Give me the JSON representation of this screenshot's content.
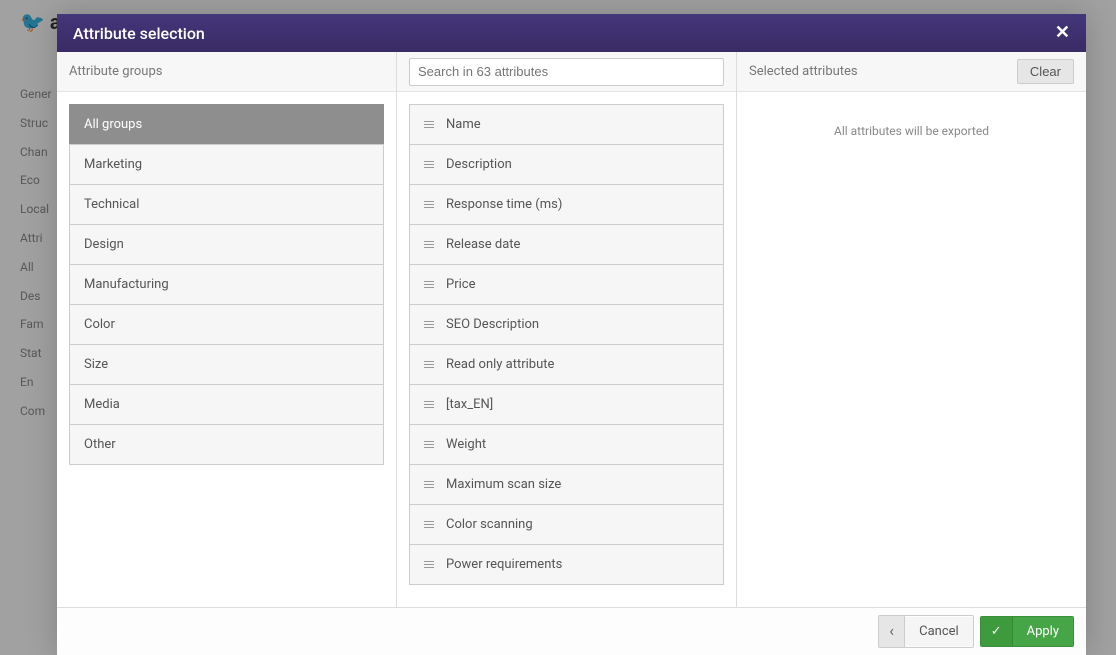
{
  "modal": {
    "title": "Attribute selection"
  },
  "columns": {
    "groups_header": "Attribute groups",
    "search_placeholder": "Search in 63 attributes",
    "selected_header": "Selected attributes",
    "clear_label": "Clear",
    "empty_message": "All attributes will be exported"
  },
  "groups": [
    {
      "label": "All groups",
      "active": true
    },
    {
      "label": "Marketing",
      "active": false
    },
    {
      "label": "Technical",
      "active": false
    },
    {
      "label": "Design",
      "active": false
    },
    {
      "label": "Manufacturing",
      "active": false
    },
    {
      "label": "Color",
      "active": false
    },
    {
      "label": "Size",
      "active": false
    },
    {
      "label": "Media",
      "active": false
    },
    {
      "label": "Other",
      "active": false
    }
  ],
  "attributes": [
    {
      "label": "Name"
    },
    {
      "label": "Description"
    },
    {
      "label": "Response time (ms)"
    },
    {
      "label": "Release date"
    },
    {
      "label": "Price"
    },
    {
      "label": "SEO Description"
    },
    {
      "label": "Read only attribute"
    },
    {
      "label": "[tax_EN]"
    },
    {
      "label": "Weight"
    },
    {
      "label": "Maximum scan size"
    },
    {
      "label": "Color scanning"
    },
    {
      "label": "Power requirements"
    }
  ],
  "footer": {
    "cancel": "Cancel",
    "apply": "Apply"
  },
  "background": {
    "logo": "ak",
    "sidebar": [
      "Gener",
      "Struc",
      "Chan",
      "Eco",
      "Local",
      "",
      "Attri",
      "All",
      "Des",
      "Fam",
      "",
      "Stat",
      "En",
      "Com"
    ]
  }
}
